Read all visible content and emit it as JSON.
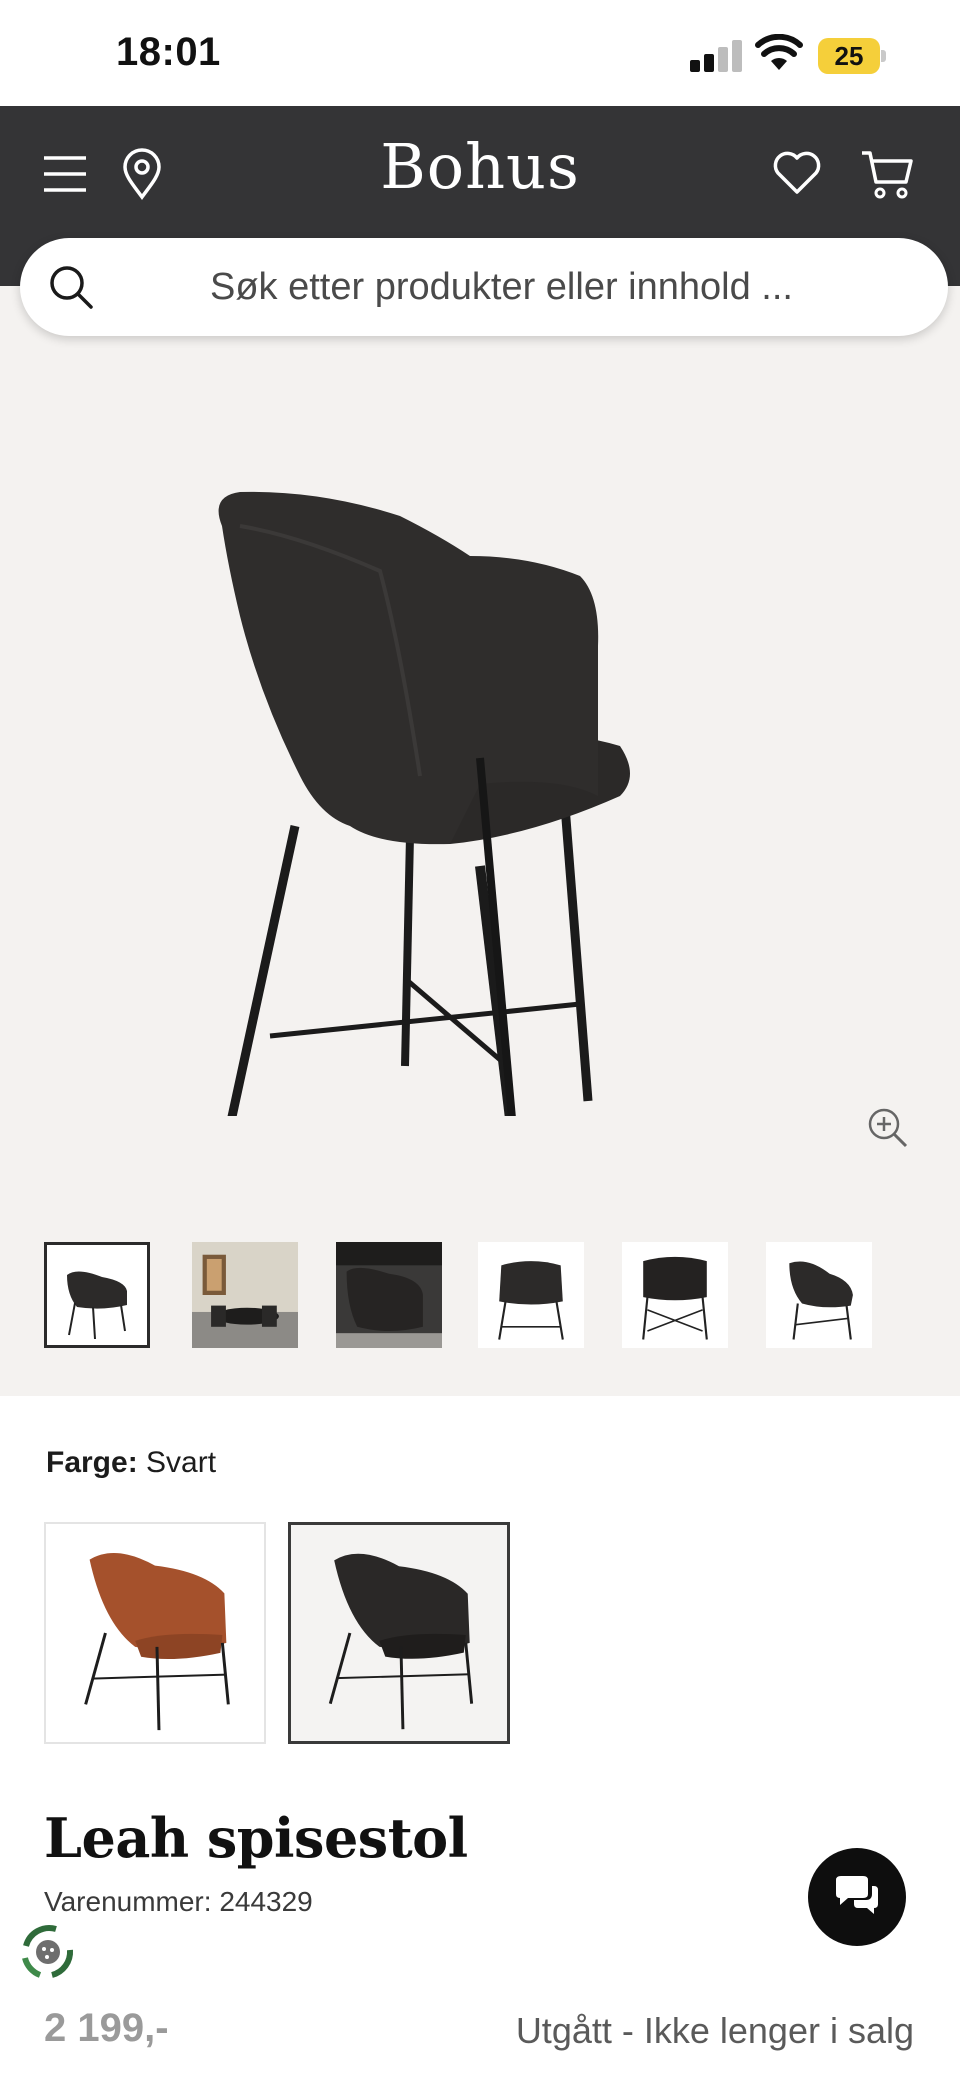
{
  "status_bar": {
    "time": "18:01",
    "battery": "25"
  },
  "header": {
    "brand": "Bohus"
  },
  "search": {
    "placeholder": "Søk etter produkter eller innhold ..."
  },
  "gallery": {
    "thumbnail_count": 6,
    "selected_thumbnail": 1
  },
  "color": {
    "label": "Farge:",
    "value": "Svart",
    "options": [
      "Rust",
      "Svart"
    ],
    "selected": "Svart"
  },
  "product": {
    "title": "Leah spisestol",
    "sku": "Varenummer: 244329",
    "price": "2 199,-",
    "availability": "Utgått - Ikke lenger i salg"
  },
  "colors": {
    "header_bg": "#343436",
    "gallery_bg": "#f4f2f0",
    "battery": "#f5cf3a",
    "rust": "#a5512c",
    "chair": "#2a2827"
  },
  "icons": [
    "menu-icon",
    "location-pin-icon",
    "heart-icon",
    "cart-icon",
    "search-icon",
    "zoom-in-icon",
    "chat-icon",
    "eco-badge-icon"
  ]
}
